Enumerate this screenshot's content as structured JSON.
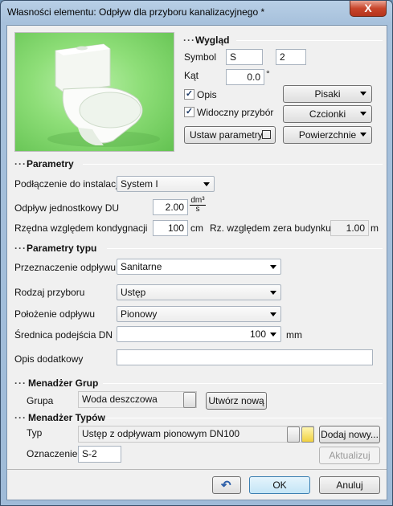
{
  "window": {
    "title": "Własności elementu: Odpływ dla przyboru kanalizacyjnego *",
    "close_label": "X"
  },
  "wyglad": {
    "section_title": "Wygląd",
    "symbol_label": "Symbol",
    "symbol_value": "S",
    "symbol_number": "2",
    "kat_label": "Kąt",
    "kat_value": "0.0",
    "kat_unit": "°",
    "opis_label": "Opis",
    "opis_checked": true,
    "widoczny_label": "Widoczny przybór",
    "widoczny_checked": true,
    "pisaki_label": "Pisaki",
    "czcionki_label": "Czcionki",
    "ustaw_label": "Ustaw parametry",
    "powierzchnie_label": "Powierzchnie"
  },
  "parametry": {
    "section_title": "Parametry",
    "podlaczenie_label": "Podłączenie do instalacji",
    "podlaczenie_value": "System I",
    "odplyw_label": "Odpływ jednostkowy DU",
    "odplyw_value": "2.00",
    "odplyw_unit_num": "dm³",
    "odplyw_unit_den": "s",
    "rzedna_label": "Rzędna względem kondygnacji",
    "rzedna_value": "100",
    "rzedna_unit": "cm",
    "rz_label": "Rz. względem zera budynku",
    "rz_value": "1.00",
    "rz_unit": "m"
  },
  "parametry_typu": {
    "section_title": "Parametry typu",
    "przeznaczenie_label": "Przeznaczenie odpływu",
    "przeznaczenie_value": "Sanitarne",
    "rodzaj_label": "Rodzaj przyboru",
    "rodzaj_value": "Ustęp",
    "polozenie_label": "Położenie odpływu",
    "polozenie_value": "Pionowy",
    "srednica_label": "Średnica podejścia DN",
    "srednica_value": "100",
    "srednica_unit": "mm",
    "opis_dod_label": "Opis dodatkowy",
    "opis_dod_value": ""
  },
  "menadzer_grup": {
    "section_title": "Menadżer Grup",
    "grupa_label": "Grupa",
    "grupa_value": "Woda deszczowa",
    "utworz_label": "Utwórz nową"
  },
  "menadzer_typow": {
    "section_title": "Menadżer Typów",
    "typ_label": "Typ",
    "typ_value": "Ustęp z odpływam pionowym DN100",
    "dodaj_label": "Dodaj nowy...",
    "oznaczenie_label": "Oznaczenie",
    "oznaczenie_value": "S-2",
    "aktualizuj_label": "Aktualizuj"
  },
  "footer": {
    "ok_label": "OK",
    "anuluj_label": "Anuluj"
  },
  "section_dots": "···",
  "colors": {
    "titlebar": "#a7c1dc",
    "close": "#c8452b",
    "dialog_bg": "#f0f0f0",
    "preview_green": "#7fd86a"
  }
}
